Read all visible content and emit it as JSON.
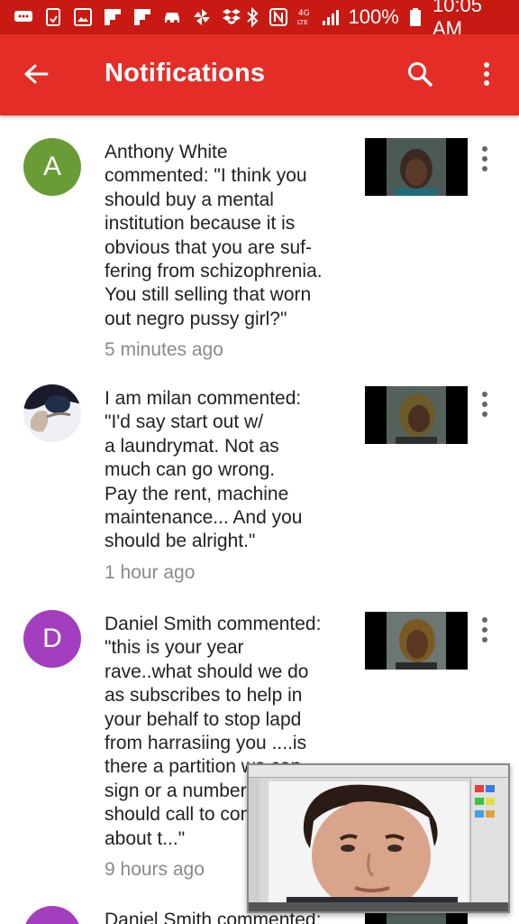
{
  "status_bar": {
    "battery_percent": "100%",
    "time": "10:05 AM",
    "left_icons": [
      "message-icon",
      "nfc-icon",
      "gallery-icon",
      "flipboard-icon",
      "flipboard-icon",
      "car-icon",
      "pinwheel-icon",
      "dropbox-icon"
    ],
    "right_icons": [
      "bluetooth-icon",
      "nfc-n-icon",
      "4g-lte-icon",
      "signal-icon",
      "battery-icon"
    ]
  },
  "app_bar": {
    "title": "Notifications",
    "back_icon": "arrow-back-icon",
    "search_icon": "search-icon",
    "more_icon": "more-vert-icon",
    "color": "#e52d27"
  },
  "notifications": [
    {
      "avatar_letter": "A",
      "avatar_color": "#6a9c36",
      "lines": [
        "Anthony White",
        "commented: \"I think you",
        "should buy a mental",
        "institution because it is",
        "obvious that you are suf-",
        "fering from schizophrenia.",
        "You still selling that worn",
        "out negro pussy girl?\""
      ],
      "time": "5 minutes ago"
    },
    {
      "avatar_letter": "",
      "avatar_color": "#e9e9ee",
      "lines": [
        "I am milan commented:",
        "\"I'd say start out w/",
        "a laundrymat. Not as",
        "much can go wrong.",
        "Pay the rent, machine",
        "maintenance... And you",
        "should be alright.\""
      ],
      "time": "1 hour ago"
    },
    {
      "avatar_letter": "D",
      "avatar_color": "#a33fbf",
      "lines": [
        "Daniel Smith commented:",
        "\"this is your year",
        "rave..what should we do",
        "as subscribes to help in",
        "your behalf to stop lapd",
        "from harrasiing you ....is",
        "there a partition we can",
        "sign or a number we",
        "should call to complain",
        "about t...\""
      ],
      "time": "9 hours ago"
    },
    {
      "avatar_letter": "D",
      "avatar_color": "#a33fbf",
      "lines": [
        "Daniel Smith commented:"
      ],
      "time": ""
    }
  ]
}
